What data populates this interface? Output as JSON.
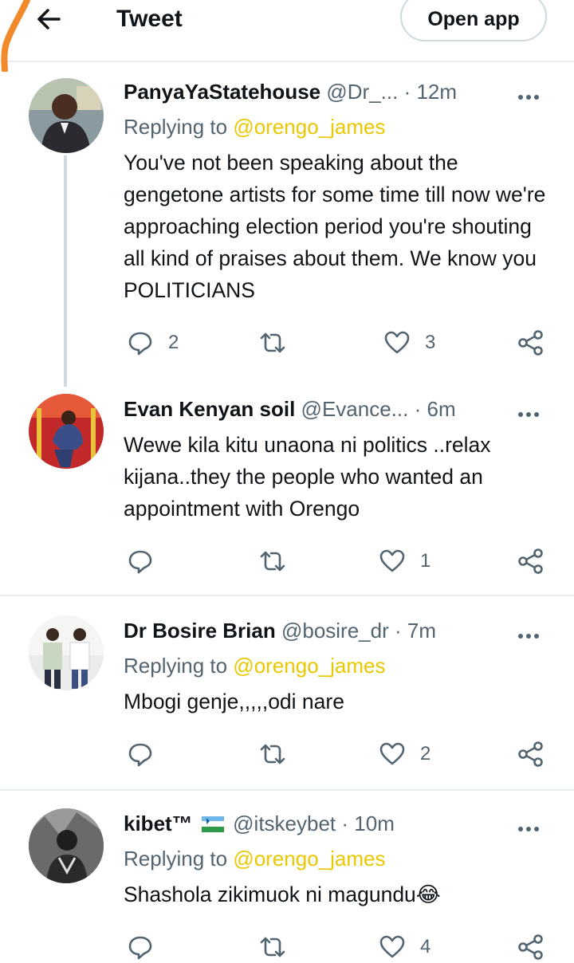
{
  "header": {
    "title": "Tweet",
    "open_app_label": "Open app"
  },
  "tweets": [
    {
      "name": "PanyaYaStatehouse",
      "handle": "@Dr_...",
      "separator": "·",
      "time": "12m",
      "replying_label": "Replying to",
      "replying_to": "@orengo_james",
      "text": "You've not been speaking about the gengetone artists for some time till now we're approaching election period you're shouting all kind of praises about them. We know you POLITICIANS",
      "replies": "2",
      "likes": "3"
    },
    {
      "name": "Evan Kenyan soil",
      "handle": "@Evance...",
      "separator": "·",
      "time": "6m",
      "text": "Wewe kila kitu unaona ni politics ..relax kijana..they the people who wanted an appointment with Orengo",
      "likes": "1"
    },
    {
      "name": "Dr Bosire Brian",
      "handle": "@bosire_dr",
      "separator": "·",
      "time": "7m",
      "replying_label": "Replying to",
      "replying_to": "@orengo_james",
      "text": "Mbogi genje,,,,,odi nare",
      "likes": "2"
    },
    {
      "name": "kibet™",
      "handle": "@itskeybet",
      "separator": "·",
      "time": "10m",
      "replying_label": "Replying to",
      "replying_to": "@orengo_james",
      "text": "Shashola zikimuok ni magundu",
      "emoji": "😂",
      "likes": "4"
    }
  ],
  "colors": {
    "accent_handle": "#e9c800",
    "secondary_text": "#536471",
    "divider": "#e6ecf0"
  },
  "icons": [
    "back-arrow-icon",
    "more-icon",
    "reply-icon",
    "retweet-icon",
    "like-icon",
    "share-icon"
  ]
}
